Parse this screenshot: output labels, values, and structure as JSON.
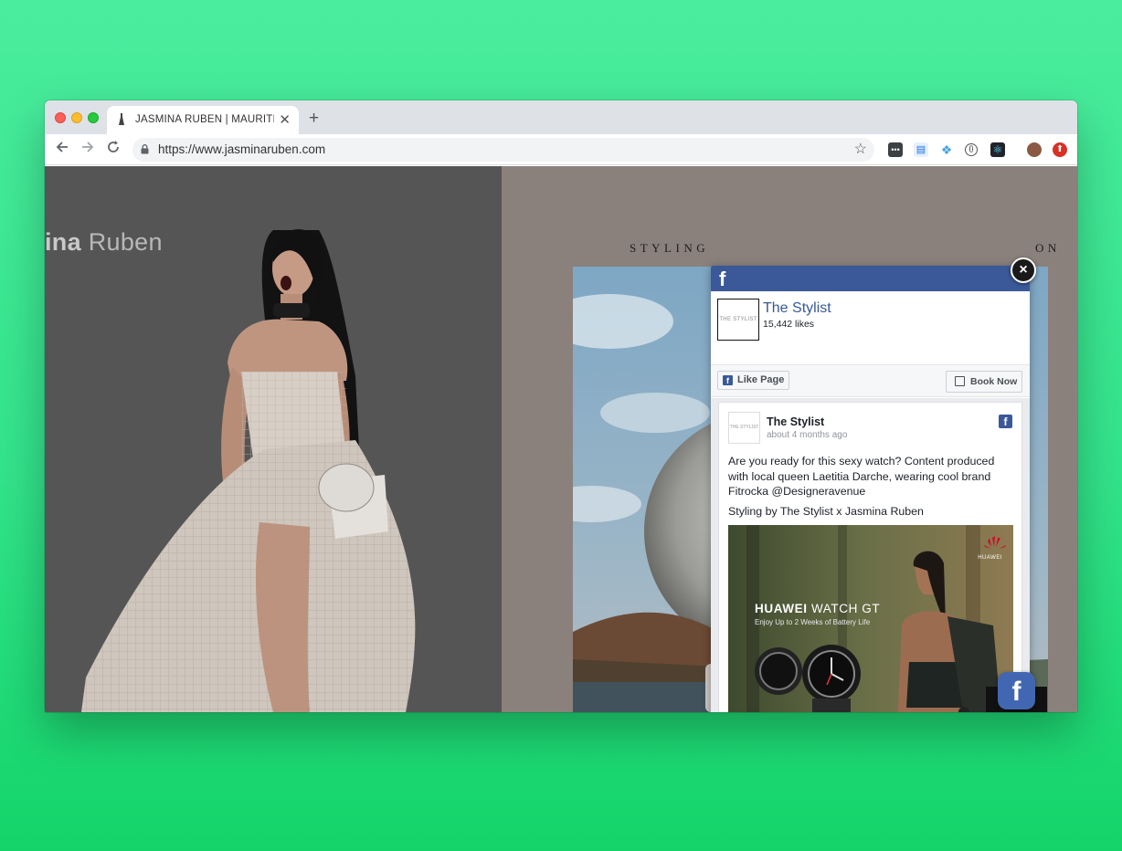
{
  "browser": {
    "tab_title": "JASMINA RUBEN | MAURITIUS",
    "tab_favicon": "dress-icon",
    "new_tab_label": "+",
    "tab_close_label": "✕",
    "url": "https://www.jasminaruben.com"
  },
  "site": {
    "brand_part1": "ina",
    "brand_part2": " Ruben",
    "styling_heading": "STYLING",
    "styling_heading_tail": "ON"
  },
  "facebook_popup": {
    "page_name": "The Stylist",
    "likes": "15,442 likes",
    "like_button": "Like Page",
    "book_button": "Book Now",
    "logo_text": "THE STYLIST",
    "post": {
      "author": "The Stylist",
      "time": "about 4 months ago",
      "paragraph1": "Are you ready for this sexy watch? Content produced with local queen Laetitia Darche, wearing cool brand Fitrocka @Designeravenue",
      "paragraph2": "Styling by The Stylist x Jasmina Ruben",
      "ad_brand_bold": "HUAWEI",
      "ad_brand_rest": " WATCH GT",
      "ad_subtitle": "Enjoy Up to 2 Weeks of Battery Life",
      "ad_logo_text": "HUAWEI"
    },
    "close_label": "×",
    "launcher_label": "f"
  },
  "colors": {
    "facebook_blue": "#3b5998",
    "background_green": "#33e38b"
  }
}
